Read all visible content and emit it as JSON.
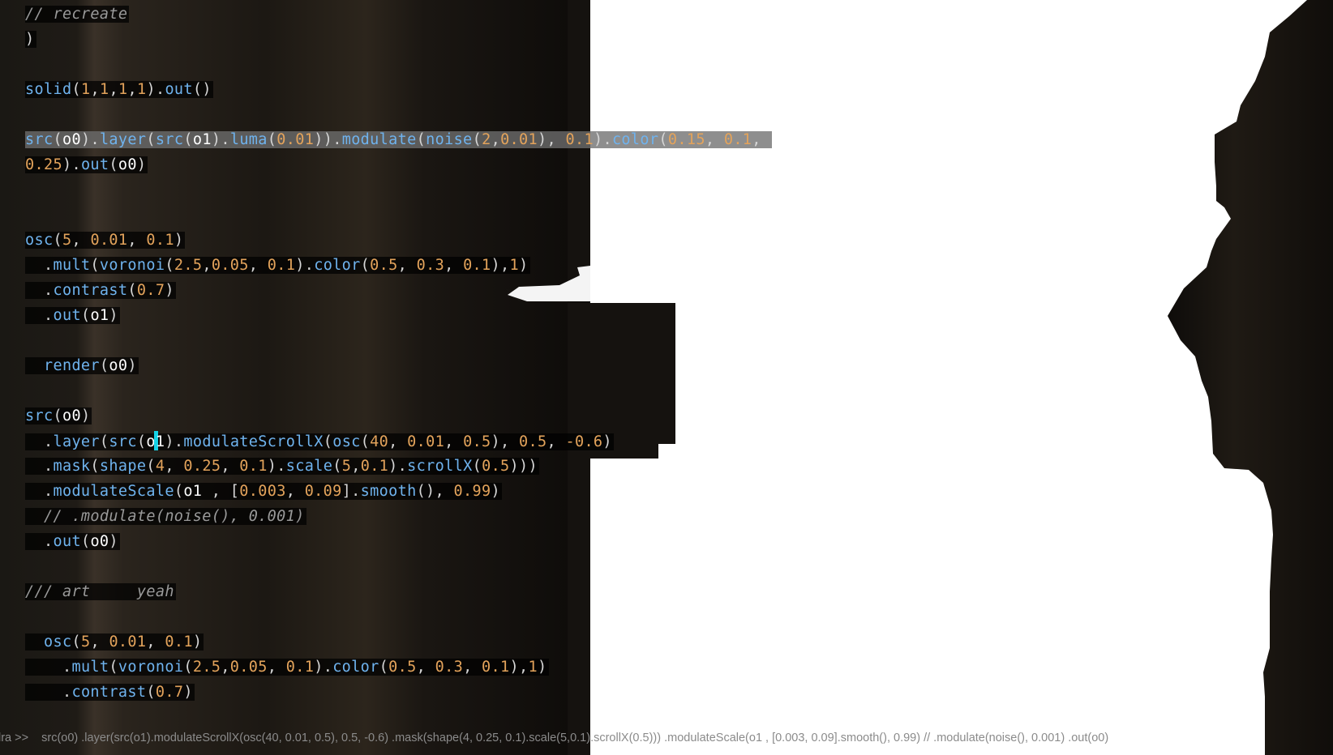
{
  "editor": {
    "lines": [
      [
        {
          "t": "// recreate",
          "c": "com"
        }
      ],
      [
        {
          "t": ")",
          "c": "punc"
        }
      ],
      [],
      [
        {
          "t": "solid",
          "c": "fn"
        },
        {
          "t": "(",
          "c": "punc"
        },
        {
          "t": "1",
          "c": "num"
        },
        {
          "t": ",",
          "c": "punc"
        },
        {
          "t": "1",
          "c": "num"
        },
        {
          "t": ",",
          "c": "punc"
        },
        {
          "t": "1",
          "c": "num"
        },
        {
          "t": ",",
          "c": "punc"
        },
        {
          "t": "1",
          "c": "num"
        },
        {
          "t": ").",
          "c": "punc"
        },
        {
          "t": "out",
          "c": "fn"
        },
        {
          "t": "()",
          "c": "punc"
        }
      ],
      [],
      [
        {
          "t": "src",
          "c": "fn"
        },
        {
          "t": "(",
          "c": "punc"
        },
        {
          "t": "o0",
          "c": "out"
        },
        {
          "t": ").",
          "c": "punc"
        },
        {
          "t": "layer",
          "c": "fn"
        },
        {
          "t": "(",
          "c": "punc"
        },
        {
          "t": "src",
          "c": "fn"
        },
        {
          "t": "(",
          "c": "punc"
        },
        {
          "t": "o1",
          "c": "out"
        },
        {
          "t": ").",
          "c": "punc"
        },
        {
          "t": "luma",
          "c": "fn"
        },
        {
          "t": "(",
          "c": "punc"
        },
        {
          "t": "0.01",
          "c": "num"
        },
        {
          "t": ")).",
          "c": "punc"
        },
        {
          "t": "modulate",
          "c": "fn"
        },
        {
          "t": "(",
          "c": "punc"
        },
        {
          "t": "noise",
          "c": "fn"
        },
        {
          "t": "(",
          "c": "punc"
        },
        {
          "t": "2",
          "c": "num"
        },
        {
          "t": ",",
          "c": "punc"
        },
        {
          "t": "0.01",
          "c": "num"
        },
        {
          "t": "), ",
          "c": "punc"
        },
        {
          "t": "0.1",
          "c": "num"
        },
        {
          "t": ").",
          "c": "punc"
        },
        {
          "t": "color",
          "c": "fn"
        },
        {
          "t": "(",
          "c": "punc"
        },
        {
          "t": "0.15",
          "c": "num"
        },
        {
          "t": ", ",
          "c": "punc"
        },
        {
          "t": "0.1",
          "c": "num"
        },
        {
          "t": ", ",
          "c": "punc"
        }
      ],
      [
        {
          "t": "0.25",
          "c": "num"
        },
        {
          "t": ").",
          "c": "punc"
        },
        {
          "t": "out",
          "c": "fn"
        },
        {
          "t": "(",
          "c": "punc"
        },
        {
          "t": "o0",
          "c": "out"
        },
        {
          "t": ")",
          "c": "punc"
        }
      ],
      [],
      [],
      [
        {
          "t": "osc",
          "c": "fn"
        },
        {
          "t": "(",
          "c": "punc"
        },
        {
          "t": "5",
          "c": "num"
        },
        {
          "t": ", ",
          "c": "punc"
        },
        {
          "t": "0.01",
          "c": "num"
        },
        {
          "t": ", ",
          "c": "punc"
        },
        {
          "t": "0.1",
          "c": "num"
        },
        {
          "t": ")",
          "c": "punc"
        }
      ],
      [
        {
          "t": "  .",
          "c": "punc"
        },
        {
          "t": "mult",
          "c": "fn"
        },
        {
          "t": "(",
          "c": "punc"
        },
        {
          "t": "voronoi",
          "c": "fn"
        },
        {
          "t": "(",
          "c": "punc"
        },
        {
          "t": "2.5",
          "c": "num"
        },
        {
          "t": ",",
          "c": "punc"
        },
        {
          "t": "0.05",
          "c": "num"
        },
        {
          "t": ", ",
          "c": "punc"
        },
        {
          "t": "0.1",
          "c": "num"
        },
        {
          "t": ").",
          "c": "punc"
        },
        {
          "t": "color",
          "c": "fn"
        },
        {
          "t": "(",
          "c": "punc"
        },
        {
          "t": "0.5",
          "c": "num"
        },
        {
          "t": ", ",
          "c": "punc"
        },
        {
          "t": "0.3",
          "c": "num"
        },
        {
          "t": ", ",
          "c": "punc"
        },
        {
          "t": "0.1",
          "c": "num"
        },
        {
          "t": "),",
          "c": "punc"
        },
        {
          "t": "1",
          "c": "num"
        },
        {
          "t": ")",
          "c": "punc"
        }
      ],
      [
        {
          "t": "  .",
          "c": "punc"
        },
        {
          "t": "contrast",
          "c": "fn"
        },
        {
          "t": "(",
          "c": "punc"
        },
        {
          "t": "0.7",
          "c": "num"
        },
        {
          "t": ")",
          "c": "punc"
        }
      ],
      [
        {
          "t": "  .",
          "c": "punc"
        },
        {
          "t": "out",
          "c": "fn"
        },
        {
          "t": "(",
          "c": "punc"
        },
        {
          "t": "o1",
          "c": "out"
        },
        {
          "t": ")",
          "c": "punc"
        }
      ],
      [],
      [
        {
          "t": "  ",
          "c": "punc"
        },
        {
          "t": "render",
          "c": "fn"
        },
        {
          "t": "(",
          "c": "punc"
        },
        {
          "t": "o0",
          "c": "out"
        },
        {
          "t": ")",
          "c": "punc"
        }
      ],
      [],
      [
        {
          "t": "src",
          "c": "fn"
        },
        {
          "t": "(",
          "c": "punc"
        },
        {
          "t": "o0",
          "c": "out"
        },
        {
          "t": ")",
          "c": "punc"
        }
      ],
      [
        {
          "t": "  .",
          "c": "punc"
        },
        {
          "t": "layer",
          "c": "fn"
        },
        {
          "t": "(",
          "c": "punc"
        },
        {
          "t": "src",
          "c": "fn"
        },
        {
          "t": "(",
          "c": "punc"
        },
        {
          "t": "o",
          "c": "out"
        },
        {
          "t": "|",
          "c": "cursor"
        },
        {
          "t": "1",
          "c": "out"
        },
        {
          "t": ").",
          "c": "punc"
        },
        {
          "t": "modulateScrollX",
          "c": "fn"
        },
        {
          "t": "(",
          "c": "punc"
        },
        {
          "t": "osc",
          "c": "fn"
        },
        {
          "t": "(",
          "c": "punc"
        },
        {
          "t": "40",
          "c": "num"
        },
        {
          "t": ", ",
          "c": "punc"
        },
        {
          "t": "0.01",
          "c": "num"
        },
        {
          "t": ", ",
          "c": "punc"
        },
        {
          "t": "0.5",
          "c": "num"
        },
        {
          "t": "), ",
          "c": "punc"
        },
        {
          "t": "0.5",
          "c": "num"
        },
        {
          "t": ", ",
          "c": "punc"
        },
        {
          "t": "-0.6",
          "c": "num"
        },
        {
          "t": ")",
          "c": "punc"
        }
      ],
      [
        {
          "t": "  .",
          "c": "punc"
        },
        {
          "t": "mask",
          "c": "fn"
        },
        {
          "t": "(",
          "c": "punc"
        },
        {
          "t": "shape",
          "c": "fn"
        },
        {
          "t": "(",
          "c": "punc"
        },
        {
          "t": "4",
          "c": "num"
        },
        {
          "t": ", ",
          "c": "punc"
        },
        {
          "t": "0.25",
          "c": "num"
        },
        {
          "t": ", ",
          "c": "punc"
        },
        {
          "t": "0.1",
          "c": "num"
        },
        {
          "t": ").",
          "c": "punc"
        },
        {
          "t": "scale",
          "c": "fn"
        },
        {
          "t": "(",
          "c": "punc"
        },
        {
          "t": "5",
          "c": "num"
        },
        {
          "t": ",",
          "c": "punc"
        },
        {
          "t": "0.1",
          "c": "num"
        },
        {
          "t": ").",
          "c": "punc"
        },
        {
          "t": "scrollX",
          "c": "fn"
        },
        {
          "t": "(",
          "c": "punc"
        },
        {
          "t": "0.5",
          "c": "num"
        },
        {
          "t": ")))",
          "c": "punc"
        }
      ],
      [
        {
          "t": "  .",
          "c": "punc"
        },
        {
          "t": "modulateScale",
          "c": "fn"
        },
        {
          "t": "(",
          "c": "punc"
        },
        {
          "t": "o1",
          "c": "out"
        },
        {
          "t": " , [",
          "c": "punc"
        },
        {
          "t": "0.003",
          "c": "num"
        },
        {
          "t": ", ",
          "c": "punc"
        },
        {
          "t": "0.09",
          "c": "num"
        },
        {
          "t": "].",
          "c": "punc"
        },
        {
          "t": "smooth",
          "c": "fn"
        },
        {
          "t": "(), ",
          "c": "punc"
        },
        {
          "t": "0.99",
          "c": "num"
        },
        {
          "t": ")",
          "c": "punc"
        }
      ],
      [
        {
          "t": "  // .modulate(noise(), 0.001)",
          "c": "com"
        }
      ],
      [
        {
          "t": "  .",
          "c": "punc"
        },
        {
          "t": "out",
          "c": "fn"
        },
        {
          "t": "(",
          "c": "punc"
        },
        {
          "t": "o0",
          "c": "out"
        },
        {
          "t": ")",
          "c": "punc"
        }
      ],
      [],
      [
        {
          "t": "/// art     yeah",
          "c": "com"
        }
      ],
      [],
      [
        {
          "t": "  ",
          "c": "punc"
        },
        {
          "t": "osc",
          "c": "fn"
        },
        {
          "t": "(",
          "c": "punc"
        },
        {
          "t": "5",
          "c": "num"
        },
        {
          "t": ", ",
          "c": "punc"
        },
        {
          "t": "0.01",
          "c": "num"
        },
        {
          "t": ", ",
          "c": "punc"
        },
        {
          "t": "0.1",
          "c": "num"
        },
        {
          "t": ")",
          "c": "punc"
        }
      ],
      [
        {
          "t": "    .",
          "c": "punc"
        },
        {
          "t": "mult",
          "c": "fn"
        },
        {
          "t": "(",
          "c": "punc"
        },
        {
          "t": "voronoi",
          "c": "fn"
        },
        {
          "t": "(",
          "c": "punc"
        },
        {
          "t": "2.5",
          "c": "num"
        },
        {
          "t": ",",
          "c": "punc"
        },
        {
          "t": "0.05",
          "c": "num"
        },
        {
          "t": ", ",
          "c": "punc"
        },
        {
          "t": "0.1",
          "c": "num"
        },
        {
          "t": ").",
          "c": "punc"
        },
        {
          "t": "color",
          "c": "fn"
        },
        {
          "t": "(",
          "c": "punc"
        },
        {
          "t": "0.5",
          "c": "num"
        },
        {
          "t": ", ",
          "c": "punc"
        },
        {
          "t": "0.3",
          "c": "num"
        },
        {
          "t": ", ",
          "c": "punc"
        },
        {
          "t": "0.1",
          "c": "num"
        },
        {
          "t": "),",
          "c": "punc"
        },
        {
          "t": "1",
          "c": "num"
        },
        {
          "t": ")",
          "c": "punc"
        }
      ],
      [
        {
          "t": "    .",
          "c": "punc"
        },
        {
          "t": "contrast",
          "c": "fn"
        },
        {
          "t": "(",
          "c": "punc"
        },
        {
          "t": "0.7",
          "c": "num"
        },
        {
          "t": ")",
          "c": "punc"
        }
      ]
    ],
    "selected_line_index": 5
  },
  "console": {
    "prompt": "lra >>",
    "command": "src(o0) .layer(src(o1).modulateScrollX(osc(40, 0.01, 0.5), 0.5, -0.6) .mask(shape(4, 0.25, 0.1).scale(5,0.1).scrollX(0.5))) .modulateScale(o1 , [0.003, 0.09].smooth(), 0.99) // .modulate(noise(), 0.001) .out(o0)"
  },
  "colors": {
    "function": "#6fb3ee",
    "number": "#e3a35b",
    "output": "#ffffff",
    "comment": "#9a9a9a",
    "cursor": "#15d2e6",
    "canvas_light": "#ffffff",
    "canvas_dark": "#120f0c"
  }
}
